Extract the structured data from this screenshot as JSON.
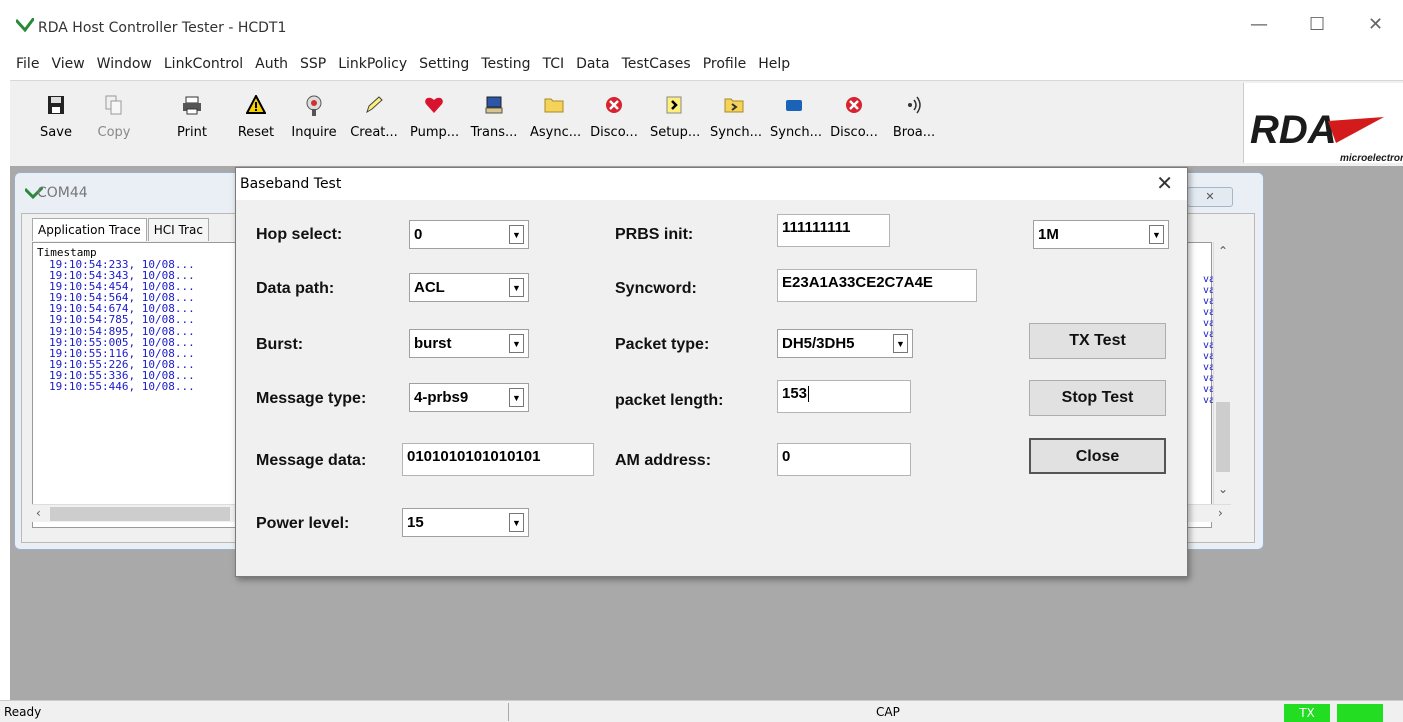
{
  "window": {
    "title": "RDA Host Controller Tester - HCDT1",
    "minimize": "—",
    "maximize": "☐",
    "close": "✕"
  },
  "menu": [
    "File",
    "View",
    "Window",
    "LinkControl",
    "Auth",
    "SSP",
    "LinkPolicy",
    "Setting",
    "Testing",
    "TCI",
    "Data",
    "TestCases",
    "Profile",
    "Help"
  ],
  "toolbar": [
    {
      "label": "Save",
      "icon": "floppy-icon",
      "enabled": true
    },
    {
      "label": "Copy",
      "icon": "copy-icon",
      "enabled": false
    },
    {
      "label": "Print",
      "icon": "printer-icon",
      "enabled": true
    },
    {
      "label": "Reset",
      "icon": "warning-icon",
      "enabled": true
    },
    {
      "label": "Inquire",
      "icon": "satellite-icon",
      "enabled": true
    },
    {
      "label": "Creat...",
      "icon": "pencil-icon",
      "enabled": true
    },
    {
      "label": "Pump...",
      "icon": "heart-icon",
      "enabled": true
    },
    {
      "label": "Trans...",
      "icon": "computer-icon",
      "enabled": true
    },
    {
      "label": "Async...",
      "icon": "folder-icon",
      "enabled": true
    },
    {
      "label": "Disco...",
      "icon": "disconnect-icon",
      "enabled": true
    },
    {
      "label": "Setup...",
      "icon": "setup-icon",
      "enabled": true
    },
    {
      "label": "Synch...",
      "icon": "sync-folder-icon",
      "enabled": true
    },
    {
      "label": "Synch...",
      "icon": "sync-link-icon",
      "enabled": true
    },
    {
      "label": "Disco...",
      "icon": "disconnect-icon",
      "enabled": true
    },
    {
      "label": "Broa...",
      "icon": "broadcast-icon",
      "enabled": true
    }
  ],
  "brand": {
    "logo_text": "RDA",
    "logo_sub": "microelectronics",
    "color": "#d31b1b"
  },
  "child_window": {
    "title": "COM44",
    "close": "✕",
    "tabs": [
      "Application Trace",
      "HCI Trac"
    ],
    "trace_header": "Timestamp",
    "trace_rows": [
      "19:10:54:233,  10/08...",
      "19:10:54:343,  10/08...",
      "19:10:54:454,  10/08...",
      "19:10:54:564,  10/08...",
      "19:10:54:674,  10/08...",
      "19:10:54:785,  10/08...",
      "19:10:54:895,  10/08...",
      "19:10:55:005,  10/08...",
      "19:10:55:116,  10/08...",
      "19:10:55:226,  10/08...",
      "19:10:55:336,  10/08...",
      "19:10:55:446,  10/08..."
    ],
    "trace_right": [
      "va.",
      "va.",
      "va.",
      "va.",
      "va.",
      "va.",
      "va.",
      "va.",
      "va.",
      "va.",
      "va.",
      "va."
    ]
  },
  "dialog": {
    "title": "Baseband Test",
    "close": "✕",
    "hop_select": {
      "label": "Hop select:",
      "value": "0"
    },
    "data_path": {
      "label": "Data path:",
      "value": "ACL"
    },
    "burst": {
      "label": "Burst:",
      "value": "burst"
    },
    "message_type": {
      "label": "Message type:",
      "value": "4-prbs9"
    },
    "message_data": {
      "label": "Message data:",
      "value": "0101010101010101"
    },
    "power_level": {
      "label": "Power level:",
      "value": "15"
    },
    "prbs_init": {
      "label": "PRBS init:",
      "value": "111111111"
    },
    "syncword": {
      "label": "Syncword:",
      "value": "E23A1A33CE2C7A4E"
    },
    "packet_type": {
      "label": "Packet type:",
      "value": "DH5/3DH5"
    },
    "packet_length": {
      "label": "packet length:",
      "value": "153"
    },
    "am_address": {
      "label": "AM address:",
      "value": "0"
    },
    "rate": {
      "value": "1M"
    },
    "tx_test": "TX Test",
    "stop_test": "Stop Test",
    "close_button": "Close"
  },
  "statusbar": {
    "ready": "Ready",
    "cap": "CAP",
    "tx": "TX",
    "tx_color": "#22dd22"
  }
}
